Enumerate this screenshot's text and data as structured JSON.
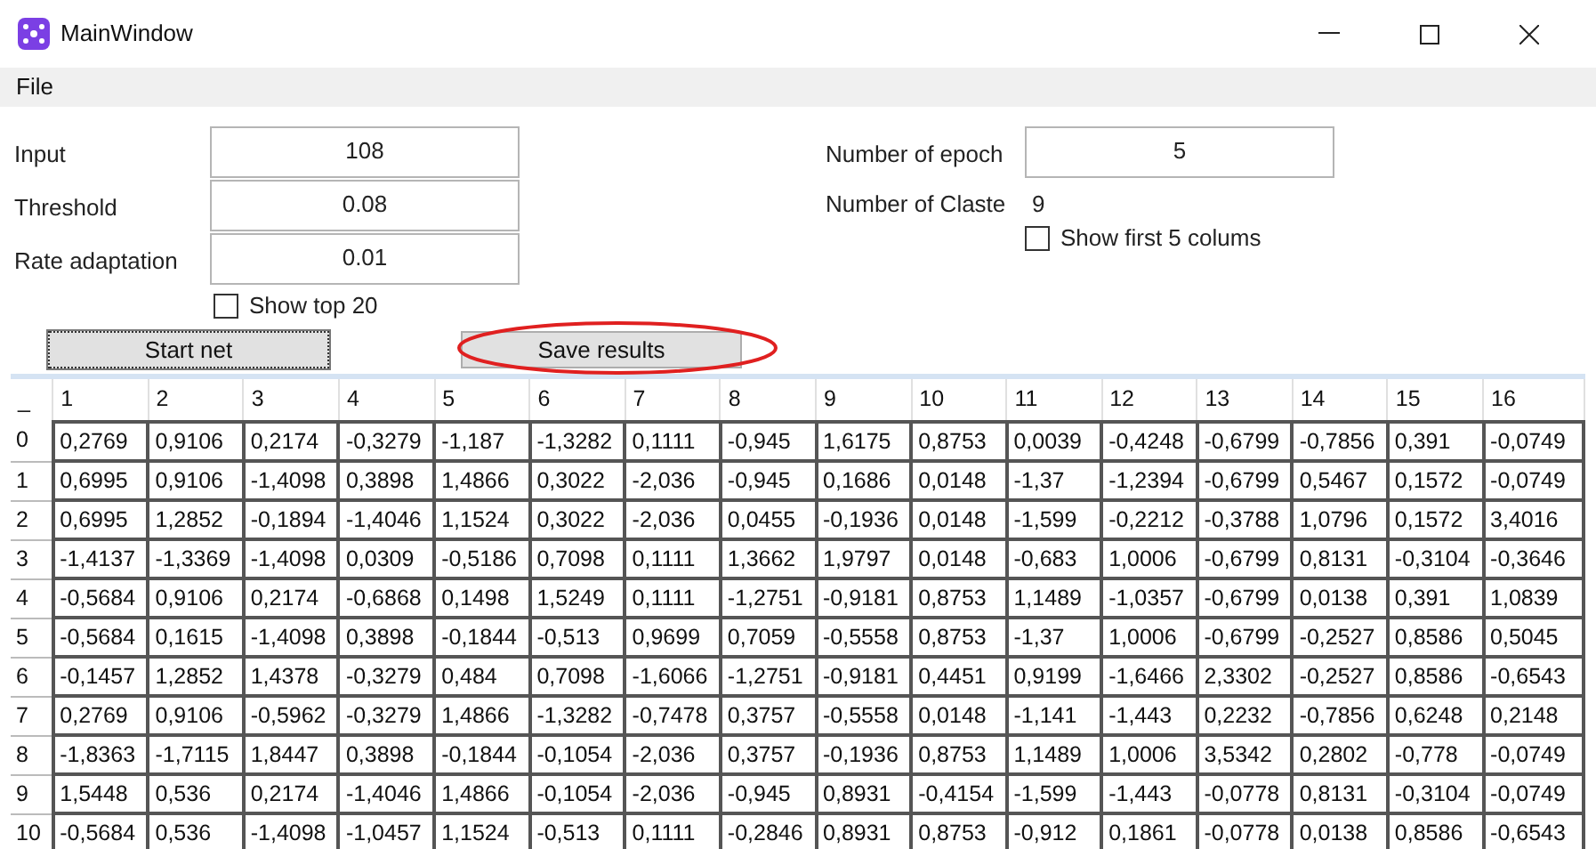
{
  "window": {
    "title": "MainWindow"
  },
  "menu": [
    "File"
  ],
  "form": {
    "left_fields": [
      {
        "label": "Input",
        "value": "108"
      },
      {
        "label": "Threshold",
        "value": "0.08"
      },
      {
        "label": "Rate adaptation",
        "value": "0.01"
      }
    ],
    "show_top": {
      "label": "Show top 20",
      "checked": false
    },
    "epochs": {
      "label": "Number of epoch",
      "value": "5"
    },
    "clusters": {
      "label": "Number of Claste",
      "value": "9"
    },
    "show_first": {
      "label": "Show first 5 colums",
      "checked": false
    },
    "buttons": [
      {
        "label": "Start net",
        "focused": true,
        "circled": false
      },
      {
        "label": "Save results",
        "focused": false,
        "circled": true
      }
    ]
  },
  "table": {
    "columns": [
      "_",
      "1",
      "2",
      "3",
      "4",
      "5",
      "6",
      "7",
      "8",
      "9",
      "10",
      "11",
      "12",
      "13",
      "14",
      "15",
      "16"
    ],
    "rows": [
      [
        "0",
        "0,2769",
        "0,9106",
        "0,2174",
        "-0,3279",
        "-1,187",
        "-1,3282",
        "0,1111",
        "-0,945",
        "1,6175",
        "0,8753",
        "0,0039",
        "-0,4248",
        "-0,6799",
        "-0,7856",
        "0,391",
        "-0,0749"
      ],
      [
        "1",
        "0,6995",
        "0,9106",
        "-1,4098",
        "0,3898",
        "1,4866",
        "0,3022",
        "-2,036",
        "-0,945",
        "0,1686",
        "0,0148",
        "-1,37",
        "-1,2394",
        "-0,6799",
        "0,5467",
        "0,1572",
        "-0,0749"
      ],
      [
        "2",
        "0,6995",
        "1,2852",
        "-0,1894",
        "-1,4046",
        "1,1524",
        "0,3022",
        "-2,036",
        "0,0455",
        "-0,1936",
        "0,0148",
        "-1,599",
        "-0,2212",
        "-0,3788",
        "1,0796",
        "0,1572",
        "3,4016"
      ],
      [
        "3",
        "-1,4137",
        "-1,3369",
        "-1,4098",
        "0,0309",
        "-0,5186",
        "0,7098",
        "0,1111",
        "1,3662",
        "1,9797",
        "0,0148",
        "-0,683",
        "1,0006",
        "-0,6799",
        "0,8131",
        "-0,3104",
        "-0,3646"
      ],
      [
        "4",
        "-0,5684",
        "0,9106",
        "0,2174",
        "-0,6868",
        "0,1498",
        "1,5249",
        "0,1111",
        "-1,2751",
        "-0,9181",
        "0,8753",
        "1,1489",
        "-1,0357",
        "-0,6799",
        "0,0138",
        "0,391",
        "1,0839"
      ],
      [
        "5",
        "-0,5684",
        "0,1615",
        "-1,4098",
        "0,3898",
        "-0,1844",
        "-0,513",
        "0,9699",
        "0,7059",
        "-0,5558",
        "0,8753",
        "-1,37",
        "1,0006",
        "-0,6799",
        "-0,2527",
        "0,8586",
        "0,5045"
      ],
      [
        "6",
        "-0,1457",
        "1,2852",
        "1,4378",
        "-0,3279",
        "0,484",
        "0,7098",
        "-1,6066",
        "-1,2751",
        "-0,9181",
        "0,4451",
        "0,9199",
        "-1,6466",
        "2,3302",
        "-0,2527",
        "0,8586",
        "-0,6543"
      ],
      [
        "7",
        "0,2769",
        "0,9106",
        "-0,5962",
        "-0,3279",
        "1,4866",
        "-1,3282",
        "-0,7478",
        "0,3757",
        "-0,5558",
        "0,0148",
        "-1,141",
        "-1,443",
        "0,2232",
        "-0,7856",
        "0,6248",
        "0,2148"
      ],
      [
        "8",
        "-1,8363",
        "-1,7115",
        "1,8447",
        "0,3898",
        "-0,1844",
        "-0,1054",
        "-2,036",
        "0,3757",
        "-0,1936",
        "0,8753",
        "1,1489",
        "1,0006",
        "3,5342",
        "0,2802",
        "-0,778",
        "-0,0749"
      ],
      [
        "9",
        "1,5448",
        "0,536",
        "0,2174",
        "-1,4046",
        "1,4866",
        "-0,1054",
        "-2,036",
        "-0,945",
        "0,8931",
        "-0,4154",
        "-1,599",
        "-1,443",
        "-0,0778",
        "0,8131",
        "-0,3104",
        "-0,0749"
      ],
      [
        "10",
        "-0,5684",
        "0,536",
        "-1,4098",
        "-1,0457",
        "1,1524",
        "-0,513",
        "0,1111",
        "-0,2846",
        "0,8931",
        "0,8753",
        "-0,912",
        "0,1861",
        "-0,0778",
        "0,0138",
        "0,8586",
        "-0,6543"
      ]
    ]
  }
}
